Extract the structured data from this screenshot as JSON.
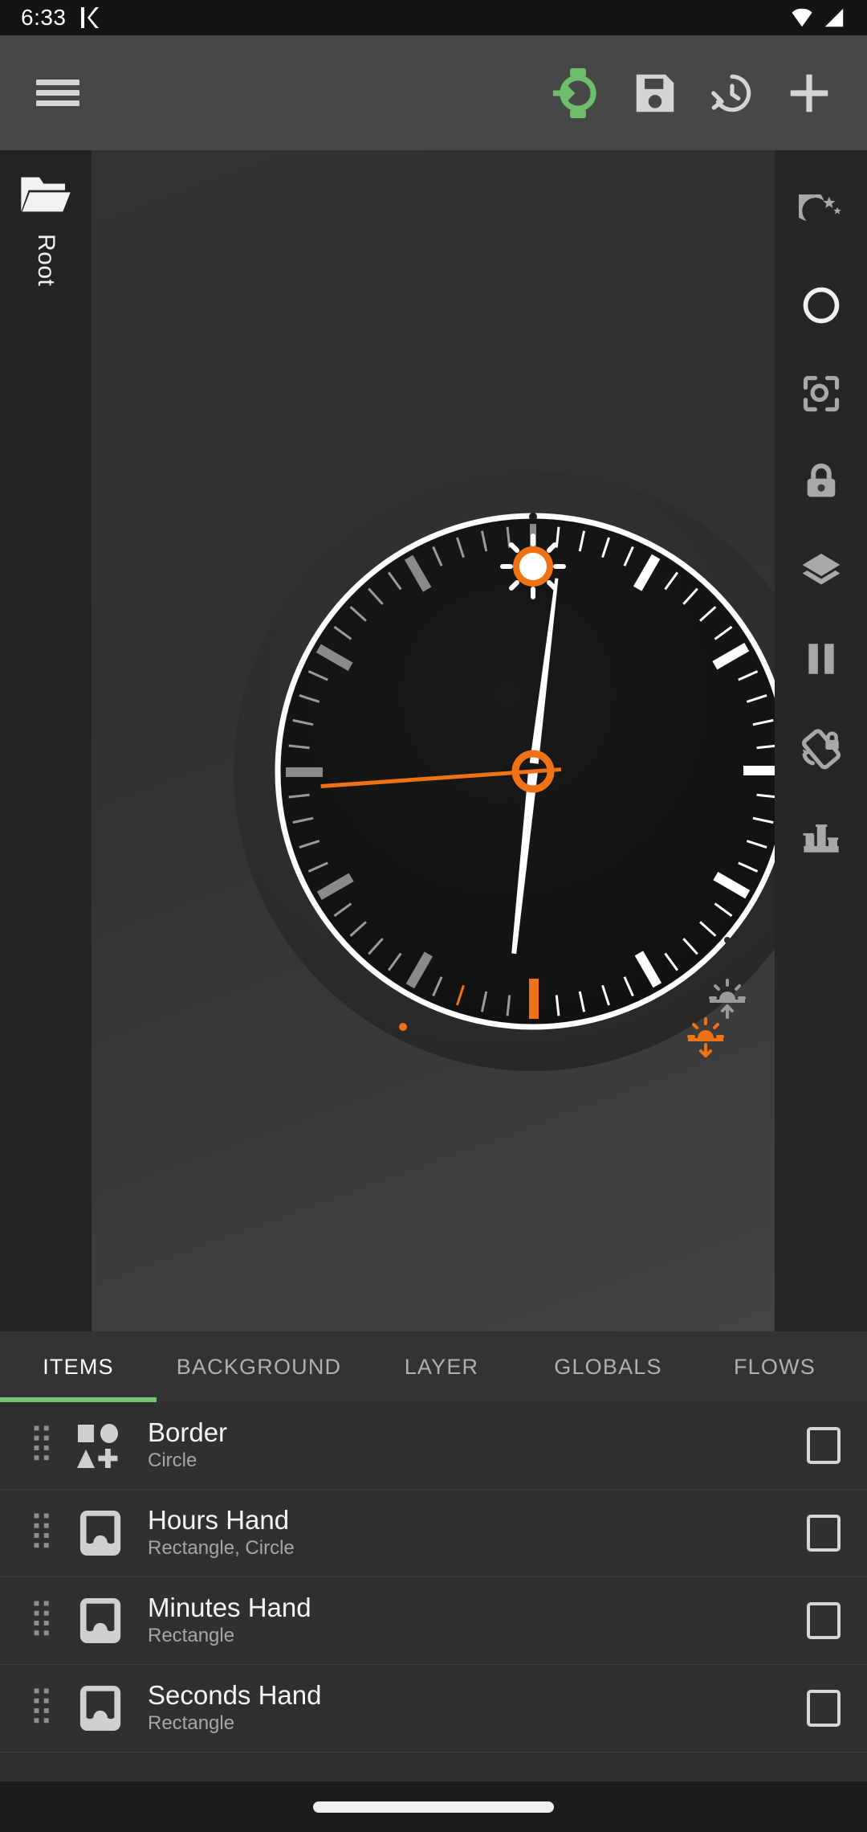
{
  "statusbar": {
    "time": "6:33",
    "left_icons": [
      "k-app-icon"
    ],
    "right_icons": [
      "wifi-icon",
      "cell-signal-icon"
    ]
  },
  "toolbar": {
    "menu_label": "hamburger-menu-icon",
    "buttons": [
      {
        "name": "send-to-watch-button",
        "icon": "watch-send-icon",
        "color": "#6dbf6d"
      },
      {
        "name": "save-button",
        "icon": "floppy-save-icon",
        "color": "#d4d4d4"
      },
      {
        "name": "history-button",
        "icon": "history-clock-icon",
        "color": "#d4d4d4"
      },
      {
        "name": "add-button",
        "icon": "plus-icon",
        "color": "#d4d4d4"
      }
    ]
  },
  "left_rail": {
    "folder_icon": "open-folder-icon",
    "label": "Root"
  },
  "tool_rail": {
    "items": [
      {
        "name": "ambient-mode-tool",
        "icon": "moon-stars-icon",
        "label": "Ambient"
      },
      {
        "name": "shape-circle-tool",
        "icon": "circle-outline-icon",
        "label": "Circle"
      },
      {
        "name": "focus-tool",
        "icon": "focus-target-icon",
        "label": "Focus"
      },
      {
        "name": "lock-tool",
        "icon": "lock-icon",
        "label": "Lock"
      },
      {
        "name": "layers-tool",
        "icon": "layers-icon",
        "label": "Layers"
      },
      {
        "name": "pause-tool",
        "icon": "pause-icon",
        "label": "Pause"
      },
      {
        "name": "rotation-lock-tool",
        "icon": "rotation-lock-icon",
        "label": "Rotation Lock"
      },
      {
        "name": "stats-tool",
        "icon": "bar-chart-icon",
        "label": "Stats"
      }
    ]
  },
  "preview": {
    "type": "watch-face-preview",
    "title": "Watch face preview",
    "colors": {
      "bezel": "#2b2b2b",
      "dial": "#141414",
      "ring": "#ffffff",
      "accent": "#ef7215",
      "tick_light": "#ffffff",
      "tick_dim": "#8a8a8a"
    },
    "complications": [
      {
        "name": "sun-indicator",
        "icon": "sun-icon",
        "color": "#ef7215"
      },
      {
        "name": "sunrise-indicator",
        "icon": "sunrise-icon",
        "color": "#9a9a9a"
      },
      {
        "name": "sunset-indicator",
        "icon": "sunset-icon",
        "color": "#ef7215"
      }
    ],
    "hands": {
      "hours_angle_deg": 186,
      "minutes_angle_deg": 187,
      "seconds_angle_deg": 266
    }
  },
  "tabs": {
    "active_index": 0,
    "items": [
      {
        "label": "ITEMS",
        "name": "tab-items"
      },
      {
        "label": "BACKGROUND",
        "name": "tab-background"
      },
      {
        "label": "LAYER",
        "name": "tab-layer"
      },
      {
        "label": "GLOBALS",
        "name": "tab-globals"
      },
      {
        "label": "FLOWS",
        "name": "tab-flows"
      }
    ]
  },
  "items": [
    {
      "title": "Border",
      "subtitle": "Circle",
      "icon": "shapes-group-icon",
      "checked": false
    },
    {
      "title": "Hours Hand",
      "subtitle": "Rectangle, Circle",
      "icon": "rounded-rect-icon",
      "checked": false
    },
    {
      "title": "Minutes Hand",
      "subtitle": "Rectangle",
      "icon": "rounded-rect-icon",
      "checked": false
    },
    {
      "title": "Seconds Hand",
      "subtitle": "Rectangle",
      "icon": "rounded-rect-icon",
      "checked": false
    }
  ],
  "navbar": {
    "pill": "gesture-nav-pill"
  }
}
